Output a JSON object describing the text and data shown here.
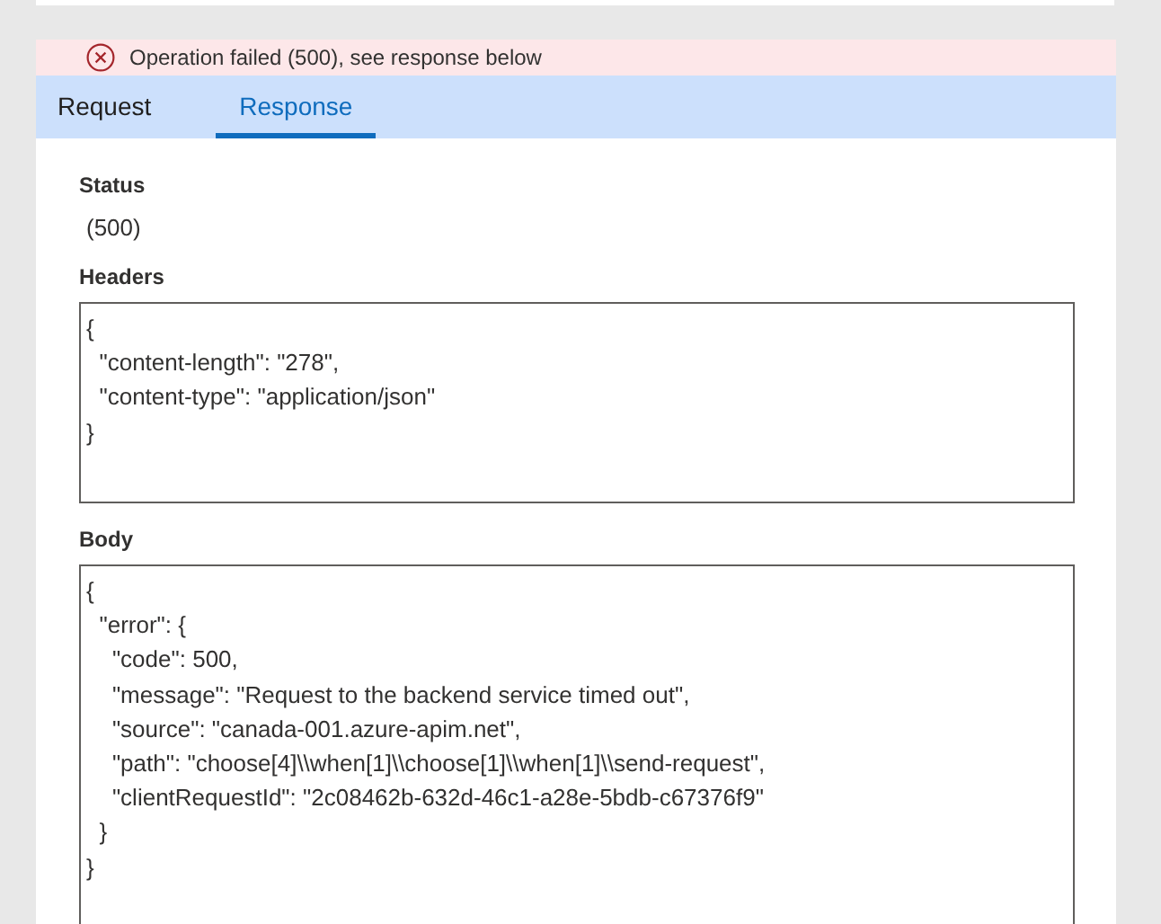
{
  "banner": {
    "kind": "error",
    "message": "Operation failed (500), see response below"
  },
  "tabs": [
    {
      "label": "Request",
      "selected": false
    },
    {
      "label": "Response",
      "selected": true
    }
  ],
  "status": {
    "label": "Status",
    "value": "(500)"
  },
  "headers": {
    "label": "Headers",
    "lines": [
      "{",
      "  \"content-length\": \"278\",",
      "  \"content-type\": \"application/json\"",
      "}"
    ]
  },
  "body": {
    "label": "Body",
    "lines": [
      "{",
      "  \"error\": {",
      "    \"code\": 500,",
      "    \"message\": \"Request to the backend service timed out\",",
      "    \"source\": \"canada-001.azure-apim.net\",",
      "    \"path\": \"choose[4]\\\\when[1]\\\\choose[1]\\\\when[1]\\\\send-request\",",
      "    \"clientRequestId\": \"2c08462b-632d-46c1-a28e-5bdb-c67376f9\"",
      "  }",
      "}"
    ]
  }
}
